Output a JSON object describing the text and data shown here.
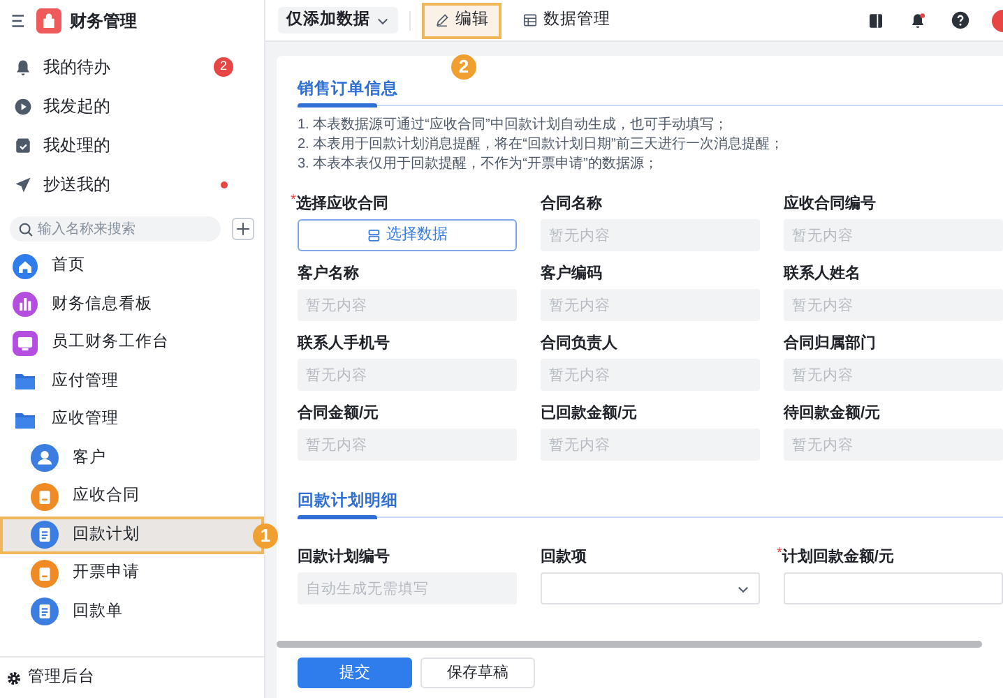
{
  "app": {
    "title": "财务管理"
  },
  "quick_items": [
    {
      "label": "我的待办",
      "kind": "bell",
      "badge": "2",
      "dot": false
    },
    {
      "label": "我发起的",
      "kind": "play",
      "dot": false
    },
    {
      "label": "我处理的",
      "kind": "inbox",
      "dot": false
    },
    {
      "label": "抄送我的",
      "kind": "send",
      "dot": true
    }
  ],
  "search": {
    "placeholder": "输入名称来搜索"
  },
  "nav": [
    {
      "label": "首页",
      "kind": "home",
      "selected": false
    },
    {
      "label": "财务信息看板",
      "kind": "chart",
      "selected": false
    },
    {
      "label": "员工财务工作台",
      "kind": "desk",
      "selected": false
    },
    {
      "label": "应付管理",
      "kind": "folder",
      "selected": false
    },
    {
      "label": "应收管理",
      "kind": "folder",
      "selected": false,
      "children": [
        {
          "label": "客户",
          "kind": "user",
          "color": "#3b7de0",
          "selected": false
        },
        {
          "label": "应收合同",
          "kind": "doc",
          "color": "#f08a24",
          "selected": false
        },
        {
          "label": "回款计划",
          "kind": "list",
          "color": "#3b7de0",
          "selected": true,
          "annotation": "1"
        },
        {
          "label": "开票申请",
          "kind": "doc",
          "color": "#f08a24",
          "selected": false
        },
        {
          "label": "回款单",
          "kind": "list",
          "color": "#3b7de0",
          "selected": false
        }
      ]
    }
  ],
  "admin": {
    "label": "管理后台"
  },
  "toolbar": {
    "mode": "仅添加数据",
    "tabs": [
      {
        "label": "编辑",
        "kind": "pen",
        "selected": true,
        "annotation": "2"
      },
      {
        "label": "数据管理",
        "kind": "table",
        "selected": false
      }
    ]
  },
  "sections": [
    {
      "title": "销售订单信息",
      "notes": [
        "1. 本表数据源可通过“应收合同”中回款计划自动生成，也可手动填写；",
        "2. 本表用于回款计划消息提醒，将在“回款计划日期”前三天进行一次消息提醒；",
        "3. 本表本表仅用于回款提醒，不作为“开票申请”的数据源；"
      ],
      "fields": [
        {
          "label": "选择应收合同",
          "mark": "*",
          "kind": "picker",
          "button": "选择数据"
        },
        {
          "label": "合同名称",
          "kind": "readonly",
          "placeholder": "暂无内容"
        },
        {
          "label": "应收合同编号",
          "kind": "readonly",
          "placeholder": "暂无内容"
        },
        {
          "label": "客户名称",
          "kind": "readonly",
          "placeholder": "暂无内容"
        },
        {
          "label": "客户编码",
          "kind": "readonly",
          "placeholder": "暂无内容"
        },
        {
          "label": "联系人姓名",
          "kind": "readonly",
          "placeholder": "暂无内容"
        },
        {
          "label": "联系人手机号",
          "kind": "readonly",
          "placeholder": "暂无内容"
        },
        {
          "label": "合同负责人",
          "kind": "readonly",
          "placeholder": "暂无内容"
        },
        {
          "label": "合同归属部门",
          "kind": "readonly",
          "placeholder": "暂无内容"
        },
        {
          "label": "合同金额/元",
          "kind": "readonly",
          "placeholder": "暂无内容"
        },
        {
          "label": "已回款金额/元",
          "kind": "readonly",
          "placeholder": "暂无内容"
        },
        {
          "label": "待回款金额/元",
          "kind": "readonly",
          "placeholder": "暂无内容"
        }
      ]
    },
    {
      "title": "回款计划明细",
      "fields": [
        {
          "label": "回款计划编号",
          "kind": "readonly",
          "placeholder": "自动生成无需填写"
        },
        {
          "label": "回款项",
          "kind": "select"
        },
        {
          "label": "计划回款金额/元",
          "mark": "*",
          "kind": "input"
        }
      ]
    }
  ],
  "actions": [
    {
      "label": "提交",
      "kind": "primary"
    },
    {
      "label": "保存草稿",
      "kind": "secondary"
    }
  ]
}
